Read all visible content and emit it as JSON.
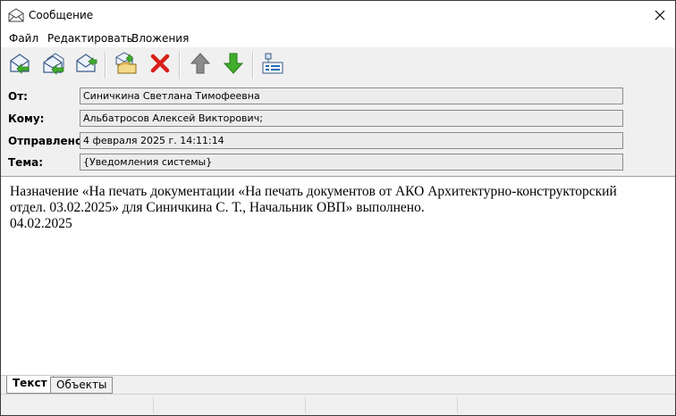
{
  "window": {
    "title": "Сообщение",
    "title_icon": "envelope-icon",
    "close_glyph": "✕"
  },
  "menu": {
    "items": [
      "Файл",
      "Редактировать",
      "Вложения"
    ]
  },
  "toolbar": {
    "buttons": [
      "reply-icon",
      "reply-all-icon",
      "forward-icon",
      "save-message-icon",
      "delete-icon",
      "previous-message-icon",
      "next-message-icon",
      "properties-icon"
    ]
  },
  "header": {
    "from_label": "От:",
    "from_value": "Синичкина Светлана Тимофеевна",
    "to_label": "Кому:",
    "to_value": "Альбатросов Алексей Викторович;",
    "sent_label": "Отправлено:",
    "sent_value": "4 февраля 2025 г. 14:11:14",
    "subject_label": "Тема:",
    "subject_value": "{Уведомления системы}"
  },
  "body": {
    "line1": "Назначение «На печать документации «На печать документов от АКО Архитектурно-конструкторский",
    "line2": "отдел. 03.02.2025» для Синичкина С. Т., Начальник ОВП» выполнено.",
    "line3": "04.02.2025"
  },
  "tabs": {
    "text": "Текст",
    "objects": "Объекты",
    "active": "Текст"
  },
  "colors": {
    "panel_bg": "#f0f0f0",
    "field_bg": "#ececec",
    "delete_red": "#d9201a",
    "arrow_green": "#3fae2a",
    "arrow_gray": "#8c8c8c",
    "envelope_blue": "#2a6fb8"
  }
}
